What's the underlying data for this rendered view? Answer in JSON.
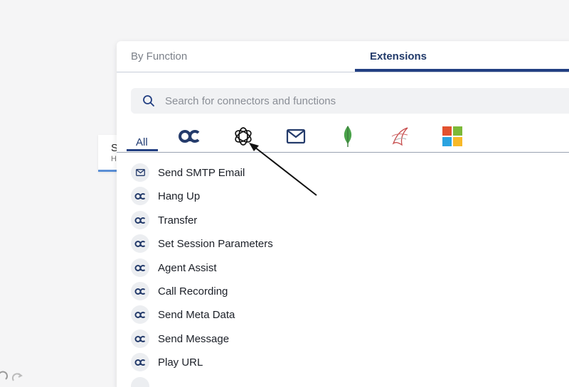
{
  "tabs": [
    {
      "label": "By Function",
      "active": false
    },
    {
      "label": "Extensions",
      "active": true
    }
  ],
  "search": {
    "placeholder": "Search for connectors and functions",
    "value": ""
  },
  "filters": {
    "all_label": "All",
    "icons": [
      "ac-logo-icon",
      "openai-icon",
      "mail-icon",
      "mongodb-icon",
      "sql-server-icon",
      "microsoft-icon"
    ]
  },
  "background_card": {
    "title": "S",
    "subtitle": "H"
  },
  "items": [
    {
      "label": "Send SMTP Email",
      "icon": "mail-icon"
    },
    {
      "label": "Hang Up",
      "icon": "ac-logo-icon"
    },
    {
      "label": "Transfer",
      "icon": "ac-logo-icon"
    },
    {
      "label": "Set Session Parameters",
      "icon": "ac-logo-icon"
    },
    {
      "label": "Agent Assist",
      "icon": "ac-logo-icon"
    },
    {
      "label": "Call Recording",
      "icon": "ac-logo-icon"
    },
    {
      "label": "Send Meta Data",
      "icon": "ac-logo-icon"
    },
    {
      "label": "Send Message",
      "icon": "ac-logo-icon"
    },
    {
      "label": "Play URL",
      "icon": "ac-logo-icon"
    }
  ],
  "colors": {
    "accent": "#223f82",
    "tab_active_text": "#213a6a",
    "badge_bg": "#eceef1"
  }
}
